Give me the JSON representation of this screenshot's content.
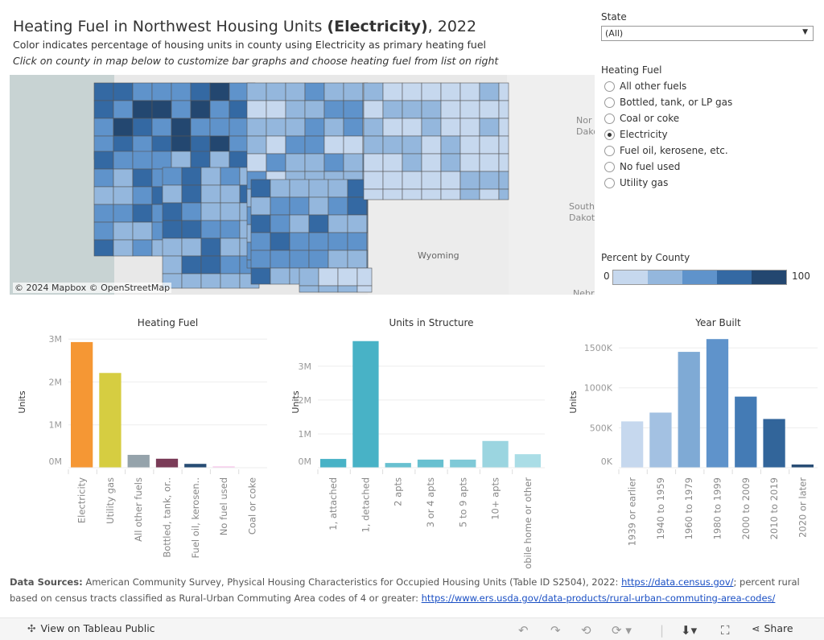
{
  "header": {
    "title_prefix": "Heating Fuel in Northwest Housing Units ",
    "title_fuel": "(Electricity)",
    "title_suffix": ", 2022",
    "subtitle": "Color indicates percentage of housing units in county using Electricity as primary heating fuel",
    "instruction": "Click on county in map below to customize bar graphs and choose heating fuel from list on right"
  },
  "map": {
    "credit": "© 2024 Mapbox © OpenStreetMap",
    "labels": [
      "Wyoming",
      "North Dakota",
      "South Dakota",
      "Nebraska"
    ],
    "label_shown": [
      "Wyoming",
      "Nor\nDako",
      "South\nDakot",
      "Nebr"
    ]
  },
  "filters": {
    "state_label": "State",
    "state_value": "(All)",
    "fuel_label": "Heating Fuel",
    "fuel_options": [
      "All other fuels",
      "Bottled, tank, or LP gas",
      "Coal or coke",
      "Electricity",
      "Fuel oil, kerosene, etc.",
      "No fuel used",
      "Utility gas"
    ],
    "fuel_selected": "Electricity"
  },
  "legend": {
    "label": "Percent by County",
    "min": "0",
    "max": "100",
    "colors": [
      "#c6d8ee",
      "#94b7dd",
      "#5f93cb",
      "#3469a3",
      "#234770"
    ]
  },
  "chart_data": [
    {
      "type": "bar",
      "title": "Heating Fuel",
      "ylabel": "Units",
      "categories": [
        "Electricity",
        "Utility gas",
        "All other fuels",
        "Bottled, tank, or..",
        "Fuel oil, kerosen..",
        "No fuel used",
        "Coal or coke"
      ],
      "values": [
        2930000,
        2210000,
        300000,
        210000,
        90000,
        30000,
        0
      ],
      "colors": [
        "#f59734",
        "#d6cd41",
        "#95a3ab",
        "#7a3b57",
        "#274c74",
        "#f7bde8",
        "#cccccc"
      ],
      "yticks": [
        0,
        1000000,
        2000000,
        3000000
      ],
      "ytick_labels": [
        "0M",
        "1M",
        "2M",
        "3M"
      ],
      "ylim": [
        0,
        3000000
      ]
    },
    {
      "type": "bar",
      "title": "Units in Structure",
      "ylabel": "Units",
      "categories": [
        "1, attached",
        "1, detached",
        "2 apts",
        "3 or 4 apts",
        "5 to 9 apts",
        "10+ apts",
        "Mobile home or other"
      ],
      "values": [
        260000,
        3740000,
        140000,
        240000,
        240000,
        790000,
        400000
      ],
      "colors": [
        "#48b2c6",
        "#48b2c6",
        "#68c0d0",
        "#68c0d0",
        "#7fc9d7",
        "#9bd5e0",
        "#aadde6"
      ],
      "yticks": [
        0,
        1000000,
        2000000,
        3000000
      ],
      "ytick_labels": [
        "0M",
        "1M",
        "2M",
        "3M"
      ],
      "ylim": [
        0,
        3800000
      ]
    },
    {
      "type": "bar",
      "title": "Year Built",
      "ylabel": "Units",
      "categories": [
        "1939 or earlier",
        "1940 to 1959",
        "1960 to 1979",
        "1980 to 1999",
        "2000 to 2009",
        "2010 to 2019",
        "2020 or later"
      ],
      "values": [
        580000,
        690000,
        1450000,
        1610000,
        890000,
        610000,
        40000
      ],
      "colors": [
        "#c6d8ee",
        "#a3c1e2",
        "#7faad5",
        "#5f93cb",
        "#447bb5",
        "#32659a",
        "#274c74"
      ],
      "yticks": [
        0,
        500000,
        1000000,
        1500000
      ],
      "ytick_labels": [
        "0K",
        "500K",
        "1000K",
        "1500K"
      ],
      "ylim": [
        0,
        1610000
      ]
    }
  ],
  "footer": {
    "sources_label": "Data Sources:",
    "sources_text": " American Community Survey, Physical Housing Characteristics for Occupied Housing Units (Table ID S2504), 2022: ",
    "link1": "https://data.census.gov/",
    "mid_text": "; percent rural based on census tracts classified as Rural-Urban Commuting Area codes of 4 or greater: ",
    "link2": "https://www.ers.usda.gov/data-products/rural-urban-commuting-area-codes/"
  },
  "toolbar": {
    "view_label": "View on Tableau Public",
    "share_label": "Share"
  }
}
